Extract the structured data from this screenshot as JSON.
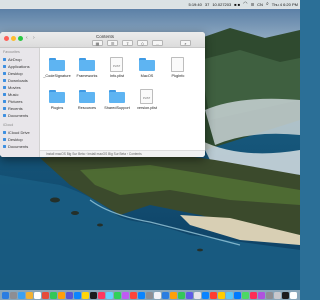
{
  "menubar": {
    "items": [
      "5:19:40",
      "37",
      "10.027203",
      "■ ■",
      "☰",
      "CN",
      "Thu 4 6:20 PM"
    ],
    "wifi_icon": "wifi-icon",
    "battery_icon": "battery-icon",
    "search_icon": "search-icon",
    "menu_icon": "list-icon"
  },
  "window": {
    "title": "Contents",
    "nav": "‹ ›",
    "toolbar_icons": [
      "grid-view-icon",
      "group-icon",
      "share-icon",
      "tag-icon",
      "more-icon",
      "search-icon"
    ]
  },
  "sidebar": {
    "sections": [
      {
        "header": "Favourites",
        "items": [
          "AirDrop",
          "Applications",
          "Desktop",
          "Downloads",
          "Movies",
          "Music",
          "Pictures",
          "Recents",
          "Documents"
        ]
      },
      {
        "header": "iCloud",
        "items": [
          "iCloud Drive",
          "Desktop",
          "Documents"
        ]
      }
    ]
  },
  "files": [
    {
      "name": "_CodeSignature",
      "kind": "folder"
    },
    {
      "name": "Frameworks",
      "kind": "folder"
    },
    {
      "name": "Info.plist",
      "kind": "document",
      "doc_text": "PLIST"
    },
    {
      "name": "MacOS",
      "kind": "folder"
    },
    {
      "name": "PkgInfo",
      "kind": "blank-document"
    },
    {
      "name": "Plugins",
      "kind": "folder"
    },
    {
      "name": "Resources",
      "kind": "folder"
    },
    {
      "name": "SharedSupport",
      "kind": "folder"
    },
    {
      "name": "version.plist",
      "kind": "document",
      "doc_text": "PLIST"
    }
  ],
  "pathbar": {
    "text": "Install macOS Big Sur Beta › Install macOS Big Sur Beta › Contents"
  },
  "dock": {
    "icon_colors": [
      "#2a7de1",
      "#8e8e93",
      "#3aa0f3",
      "#f2b134",
      "#ffffff",
      "#e64c3c",
      "#34c759",
      "#ff9f0a",
      "#5856d6",
      "#0a84ff",
      "#ffd60a",
      "#1c1c1e",
      "#ff375f",
      "#64d2ff",
      "#30d158",
      "#bf5af2",
      "#ff453a",
      "#0a84ff",
      "#8e8e93",
      "#f2f2f7",
      "#2a7de1",
      "#ff9f0a",
      "#34c759",
      "#5e5ce6",
      "#e5e5ea",
      "#0a84ff",
      "#ff3b30",
      "#ffcc00",
      "#5ac8fa",
      "#007aff",
      "#4cd964",
      "#ff2d55",
      "#af52de",
      "#8e8e93",
      "#c7c7cc",
      "#1c1c1e",
      "#ffffff"
    ]
  },
  "colors": {
    "folder": "#5eb4f2",
    "sidebar_icon": "#3d8fe0"
  }
}
